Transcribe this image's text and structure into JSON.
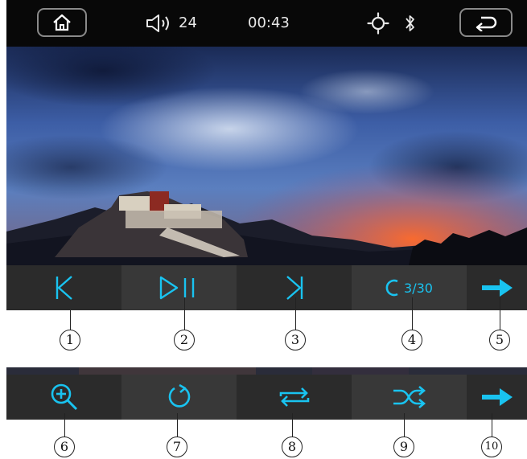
{
  "status": {
    "volume": "24",
    "time": "00:43"
  },
  "player": {
    "track_counter": "3/30"
  },
  "callouts": [
    "1",
    "2",
    "3",
    "4",
    "5",
    "6",
    "7",
    "8",
    "9",
    "10"
  ],
  "colors": {
    "accent": "#19c3f0",
    "bar": "#2b2b2b",
    "status_bg": "#080808"
  },
  "icons": {
    "home": "home-icon",
    "volume": "speaker-icon",
    "brightness": "brightness-icon",
    "bluetooth": "bluetooth-icon",
    "back": "back-icon",
    "row1": [
      "previous-icon",
      "play-pause-icon",
      "next-icon",
      "repeat-icon",
      "arrow-right-icon"
    ],
    "row2": [
      "zoom-in-icon",
      "rotate-icon",
      "repeat-all-icon",
      "shuffle-icon",
      "arrow-right-icon"
    ]
  }
}
